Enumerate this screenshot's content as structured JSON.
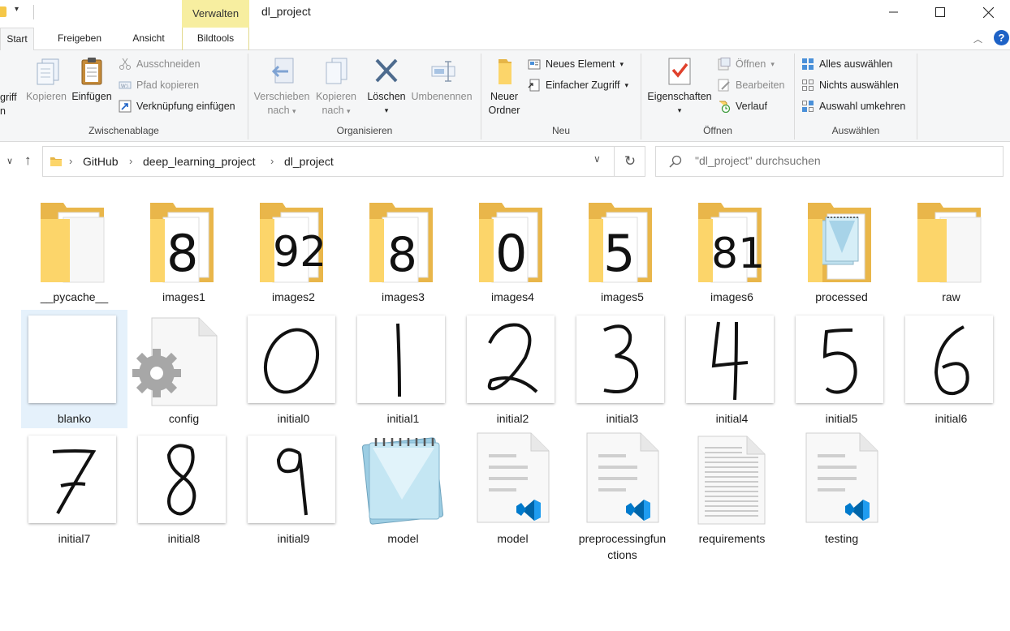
{
  "window": {
    "title": "dl_project",
    "context_tab": "Verwalten"
  },
  "ribbon_tabs": [
    "Start",
    "Freigeben",
    "Ansicht",
    "Bildtools"
  ],
  "ribbon": {
    "clipboard": {
      "label": "Zwischenablage",
      "pin_partial": "griff",
      "copy": "Kopieren",
      "paste": "Einfügen",
      "cut": "Ausschneiden",
      "copy_path": "Pfad kopieren",
      "paste_shortcut": "Verknüpfung einfügen"
    },
    "organize": {
      "label": "Organisieren",
      "move_to_1": "Verschieben",
      "move_to_2": "nach",
      "copy_to_1": "Kopieren",
      "copy_to_2": "nach",
      "delete": "Löschen",
      "rename": "Umbenennen"
    },
    "new": {
      "label": "Neu",
      "new_folder_1": "Neuer",
      "new_folder_2": "Ordner",
      "new_item": "Neues Element",
      "easy_access": "Einfacher Zugriff"
    },
    "open": {
      "label": "Öffnen",
      "properties": "Eigenschaften",
      "open": "Öffnen",
      "edit": "Bearbeiten",
      "history": "Verlauf"
    },
    "select": {
      "label": "Auswählen",
      "select_all": "Alles auswählen",
      "select_none": "Nichts auswählen",
      "invert": "Auswahl umkehren"
    }
  },
  "address": {
    "breadcrumbs": [
      "GitHub",
      "deep_learning_project",
      "dl_project"
    ]
  },
  "search": {
    "placeholder": "\"dl_project\" durchsuchen"
  },
  "files": [
    {
      "name": "__pycache__",
      "kind": "folder-empty"
    },
    {
      "name": "images1",
      "kind": "folder-digit",
      "preview": "8"
    },
    {
      "name": "images2",
      "kind": "folder-digit",
      "preview": "92"
    },
    {
      "name": "images3",
      "kind": "folder-digit",
      "preview": "8"
    },
    {
      "name": "images4",
      "kind": "folder-digit",
      "preview": "0"
    },
    {
      "name": "images5",
      "kind": "folder-digit",
      "preview": "5"
    },
    {
      "name": "images6",
      "kind": "folder-digit",
      "preview": "81"
    },
    {
      "name": "processed",
      "kind": "folder-notepad"
    },
    {
      "name": "raw",
      "kind": "folder-empty"
    },
    {
      "name": "blanko",
      "kind": "image-blank"
    },
    {
      "name": "config",
      "kind": "config-file"
    },
    {
      "name": "initial0",
      "kind": "image-digit",
      "preview": "0"
    },
    {
      "name": "initial1",
      "kind": "image-digit",
      "preview": "1"
    },
    {
      "name": "initial2",
      "kind": "image-digit",
      "preview": "2"
    },
    {
      "name": "initial3",
      "kind": "image-digit",
      "preview": "3"
    },
    {
      "name": "initial4",
      "kind": "image-digit",
      "preview": "4"
    },
    {
      "name": "initial5",
      "kind": "image-digit",
      "preview": "5"
    },
    {
      "name": "initial6",
      "kind": "image-digit",
      "preview": "6"
    },
    {
      "name": "initial7",
      "kind": "image-digit",
      "preview": "7"
    },
    {
      "name": "initial8",
      "kind": "image-digit",
      "preview": "8"
    },
    {
      "name": "initial9",
      "kind": "image-digit",
      "preview": "9"
    },
    {
      "name": "model",
      "kind": "notepad"
    },
    {
      "name": "model",
      "kind": "vscode-file"
    },
    {
      "name": "preprocessingfun",
      "name_line2": "ctions",
      "kind": "vscode-file"
    },
    {
      "name": "requirements",
      "kind": "text-file"
    },
    {
      "name": "testing",
      "kind": "vscode-file"
    }
  ],
  "colors": {
    "accent": "#1e62c6",
    "folder": "#fcd56a",
    "context_tab": "#f7eea0",
    "selection": "#cce8ff"
  }
}
